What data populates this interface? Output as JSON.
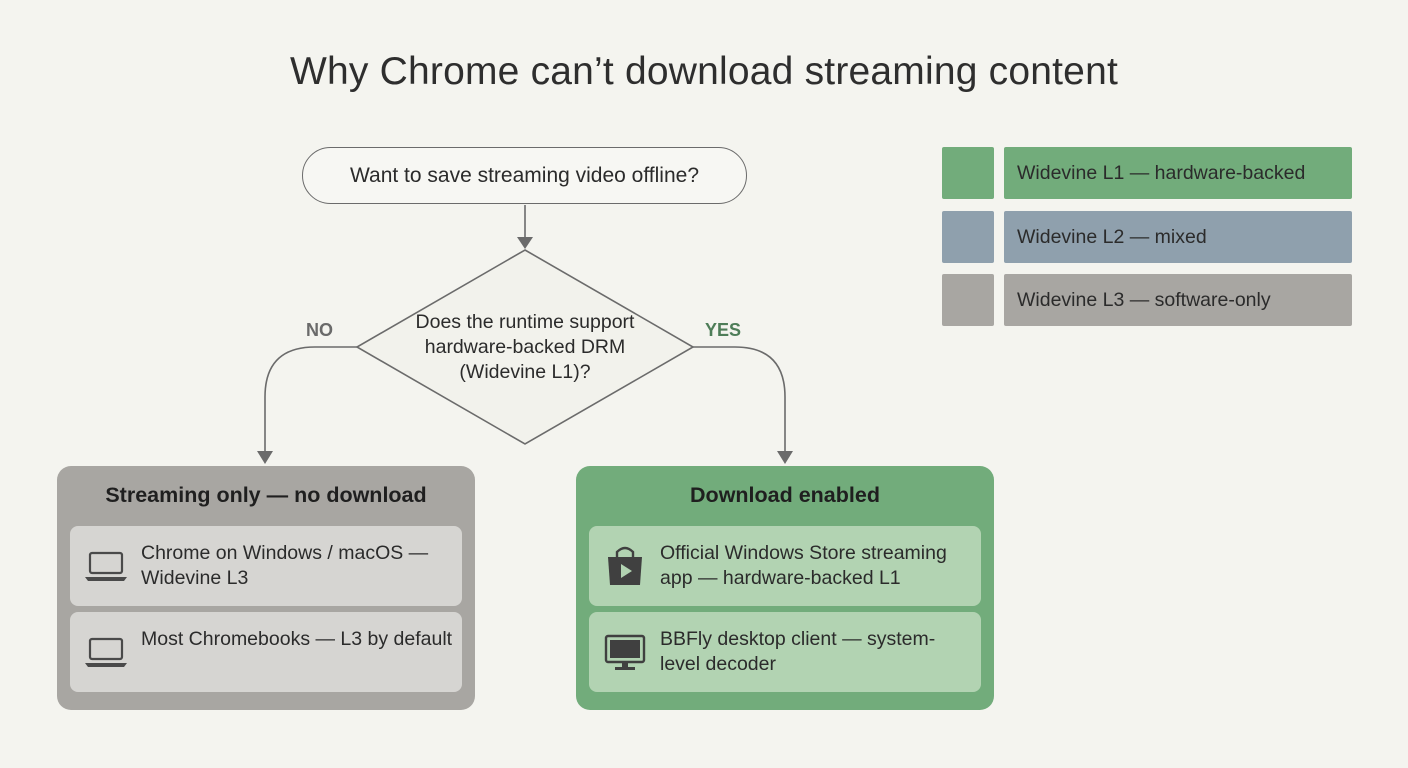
{
  "title": "Why Chrome can’t download streaming content",
  "flow": {
    "start": "Want to save streaming video offline?",
    "decision": "Does the runtime support hardware-backed DRM (Widevine L1)?",
    "no_label": "NO",
    "yes_label": "YES"
  },
  "outcomes": {
    "no": {
      "title": "Streaming only — no download",
      "items": [
        {
          "icon": "laptop-icon",
          "text": "Chrome on Windows / macOS — Widevine L3"
        },
        {
          "icon": "laptop-icon",
          "text": "Most Chromebooks — L3 by default"
        }
      ]
    },
    "yes": {
      "title": "Download enabled",
      "items": [
        {
          "icon": "store-bag-play-icon",
          "text": "Official Windows Store streaming app — hardware-backed L1"
        },
        {
          "icon": "monitor-icon",
          "text": "BBFly desktop client — system-level decoder"
        }
      ]
    }
  },
  "legend": [
    {
      "label": "Widevine L1 — hardware-backed",
      "color": "#72ac7b"
    },
    {
      "label": "Widevine L2 — mixed",
      "color": "#8fa0ad"
    },
    {
      "label": "Widevine L3 — software-only",
      "color": "#a8a6a2"
    }
  ],
  "colors": {
    "background": "#f4f4ef",
    "no_panel": "#a8a6a2",
    "no_card": "#d6d5d2",
    "yes_panel": "#72ac7b",
    "yes_card": "#b2d3b2",
    "yes_label": "#4e7d58",
    "connector": "#6b6b6b"
  }
}
